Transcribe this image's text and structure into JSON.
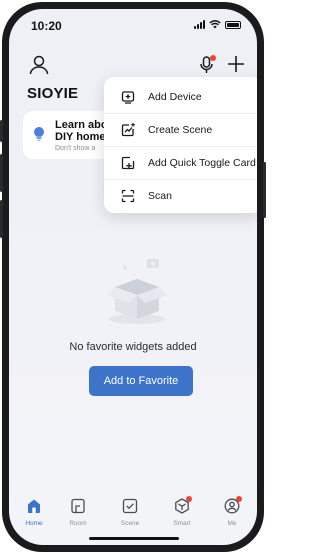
{
  "status_bar": {
    "time": "10:20"
  },
  "header": {
    "title": "SIOYIE"
  },
  "learn_card": {
    "title": "Learn abo DIY home",
    "subtitle": "Don't show a"
  },
  "menu": {
    "items": [
      {
        "label": "Add Device",
        "icon": "add-device-icon"
      },
      {
        "label": "Create Scene",
        "icon": "create-scene-icon"
      },
      {
        "label": "Add Quick Toggle Card",
        "icon": "quick-toggle-icon"
      },
      {
        "label": "Scan",
        "icon": "scan-icon"
      }
    ]
  },
  "empty_state": {
    "message": "No favorite widgets added",
    "button_label": "Add to Favorite"
  },
  "tabbar": {
    "items": [
      {
        "label": "Home",
        "icon": "home-icon",
        "active": true
      },
      {
        "label": "Room",
        "icon": "room-icon"
      },
      {
        "label": "Scene",
        "icon": "scene-icon"
      },
      {
        "label": "Smart",
        "icon": "smart-icon",
        "badge": true
      },
      {
        "label": "Me",
        "icon": "me-icon",
        "badge": true
      }
    ]
  },
  "colors": {
    "accent": "#3d73c8",
    "badge": "#e9463b",
    "background": "#f1f2f7"
  }
}
